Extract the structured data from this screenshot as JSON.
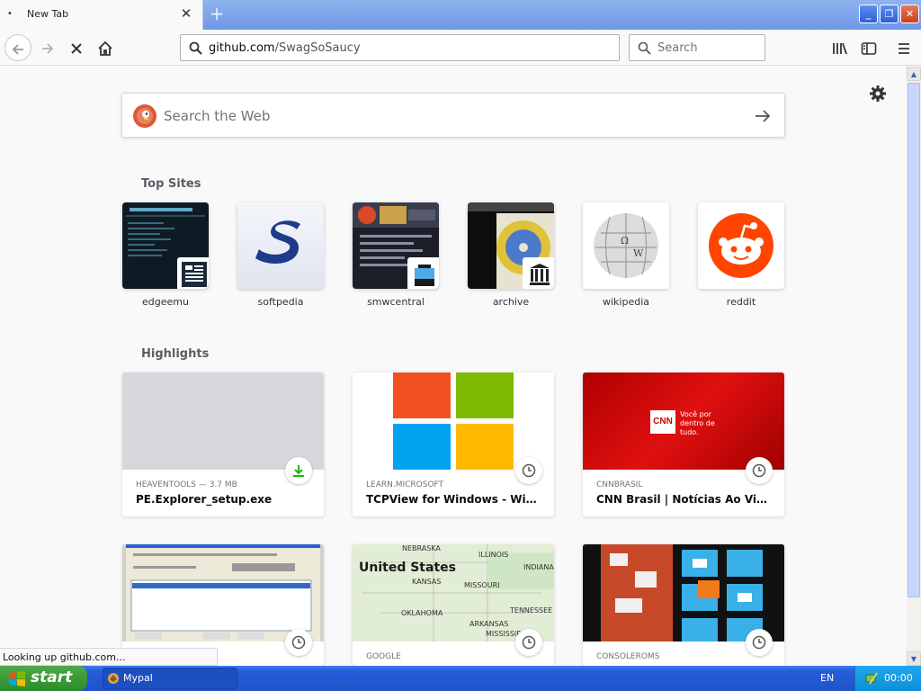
{
  "browser": {
    "tab": {
      "title": "New Tab",
      "dot": "•"
    },
    "url": {
      "host": "github.com",
      "path": "/SwagSoSaucy"
    },
    "search": {
      "placeholder": "Search"
    },
    "win_buttons": [
      "_",
      "❐",
      "✕"
    ]
  },
  "newtab": {
    "web_search": {
      "placeholder": "Search the Web"
    },
    "top_sites_title": "Top Sites",
    "top_sites": [
      {
        "label": "edgeemu"
      },
      {
        "label": "softpedia"
      },
      {
        "label": "smwcentral"
      },
      {
        "label": "archive"
      },
      {
        "label": "wikipedia"
      },
      {
        "label": "reddit"
      }
    ],
    "highlights_title": "Highlights",
    "highlights": [
      {
        "context": "HEAVENTOOLS — 3.7 MB",
        "title": "PE.Explorer_setup.exe",
        "indicator": "download-icon"
      },
      {
        "context": "LEARN.MICROSOFT",
        "title": "TCPView for Windows - Windows Sysinternals | Microsoft Learn",
        "indicator": "history-icon"
      },
      {
        "context": "CNNBRASIL",
        "title": "CNN Brasil | Notícias Ao Vivo do Brasil e do Mundo",
        "indicator": "history-icon"
      },
      {
        "context": "",
        "title": "",
        "indicator": "history-icon"
      },
      {
        "context": "GOOGLE",
        "title": "",
        "indicator": "history-icon"
      },
      {
        "context": "CONSOLEROMS",
        "title": "",
        "indicator": "history-icon"
      }
    ],
    "cnn_tagline": "Você por dentro de tudo.",
    "map_title": "United States",
    "map_labels": [
      "NEBRASKA",
      "ILLINOIS",
      "INDIANA",
      "KANSAS",
      "MISSOURI",
      "OKLAHOMA",
      "ARKANSAS",
      "TENNESSEE",
      "MISSISSIPPI"
    ]
  },
  "status": {
    "text": "Looking up github.com..."
  },
  "taskbar": {
    "start_label": "start",
    "task_label": "Mypal",
    "lang": "EN",
    "clock": "00:00"
  },
  "colors": {
    "accent": "#0a84ff",
    "reddit": "#ff4500",
    "cnn_red": "#cc0000",
    "download_green": "#12bc00"
  }
}
